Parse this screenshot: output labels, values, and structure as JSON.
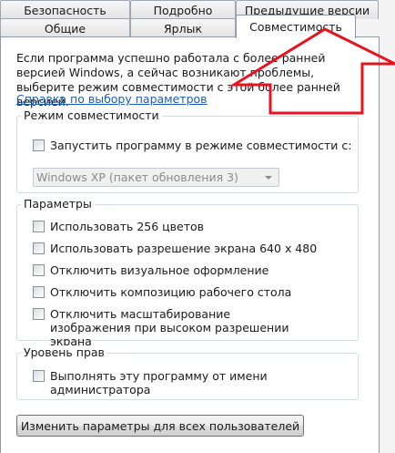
{
  "tabs": {
    "row1": [
      "Безопасность",
      "Подробно",
      "Предыдущие версии"
    ],
    "row2": [
      "Общие",
      "Ярлык",
      "Совместимость"
    ]
  },
  "intro_text": "Если программа успешно работала с более ранней версией Windows, а сейчас возникают проблемы, выберите режим совместимости с этой более ранней версией.",
  "help_link": "Справка по выбору параметров",
  "compat_group": {
    "title": "Режим совместимости",
    "checkbox_label": "Запустить программу в режиме совместимости с:",
    "combo_value": "Windows XP (пакет обновления 3)"
  },
  "params_group": {
    "title": "Параметры",
    "options": [
      "Использовать 256 цветов",
      "Использовать разрешение экрана 640 x 480",
      "Отключить визуальное оформление",
      "Отключить композицию рабочего стола",
      "Отключить масштабирование изображения при высоком разрешении экрана"
    ]
  },
  "privilege_group": {
    "title": "Уровень прав",
    "checkbox_label": "Выполнять эту программу от имени администратора"
  },
  "all_users_button": "Изменить параметры для всех пользователей",
  "colors": {
    "link": "#1a5fb4",
    "annotation_arrow": "#e8131f"
  }
}
